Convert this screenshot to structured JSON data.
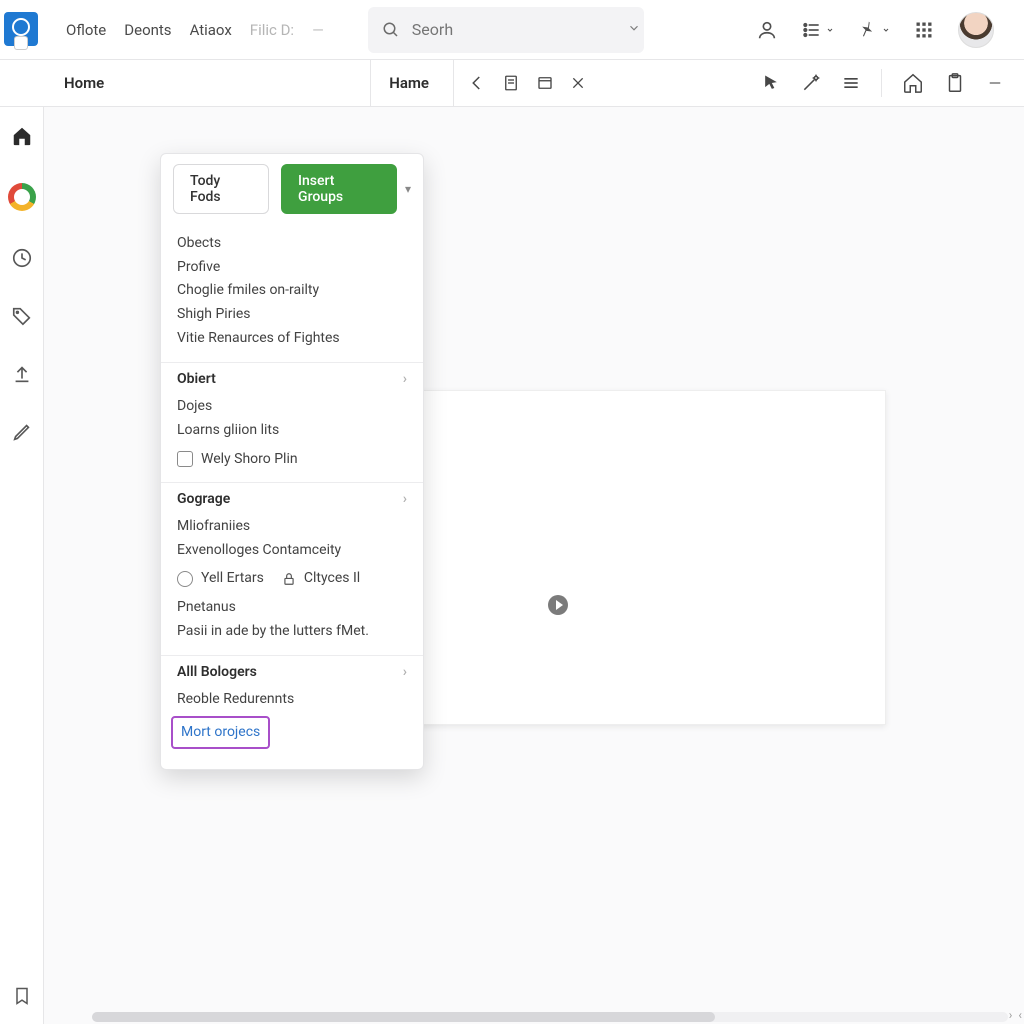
{
  "topbar": {
    "menus": [
      "Oflote",
      "Deonts",
      "Atiaox"
    ],
    "faded": "Filic D:",
    "search_placeholder": "Seorh"
  },
  "ribbon": {
    "tab_home": "Home",
    "field_hame": "Hame"
  },
  "panel": {
    "pill_left": "Tody Fods",
    "pill_right": "Insert Groups",
    "section1": {
      "lines": [
        "Obects",
        "Profive",
        "Choglie fmiles on-railty",
        "Shigh Piries",
        "Vitie Renaurces of Fightes"
      ]
    },
    "section2": {
      "head": "Obiert",
      "lines": [
        "Dojes",
        "Loarns gliion lits"
      ],
      "checkbox": "Wely Shoro Plin"
    },
    "section3": {
      "head": "Gograge",
      "lines": [
        "Mliofraniies",
        "Exvenolloges Contamceity"
      ],
      "radio": "Yell Ertars",
      "lock": "Cltyces Il",
      "para": [
        "Pnetanus",
        "Pasii in ade by the lutters fMet."
      ]
    },
    "section4": {
      "head": "Alll Bologers",
      "line": "Reoble Redurennts",
      "highlight": "Mort orojecs"
    }
  }
}
